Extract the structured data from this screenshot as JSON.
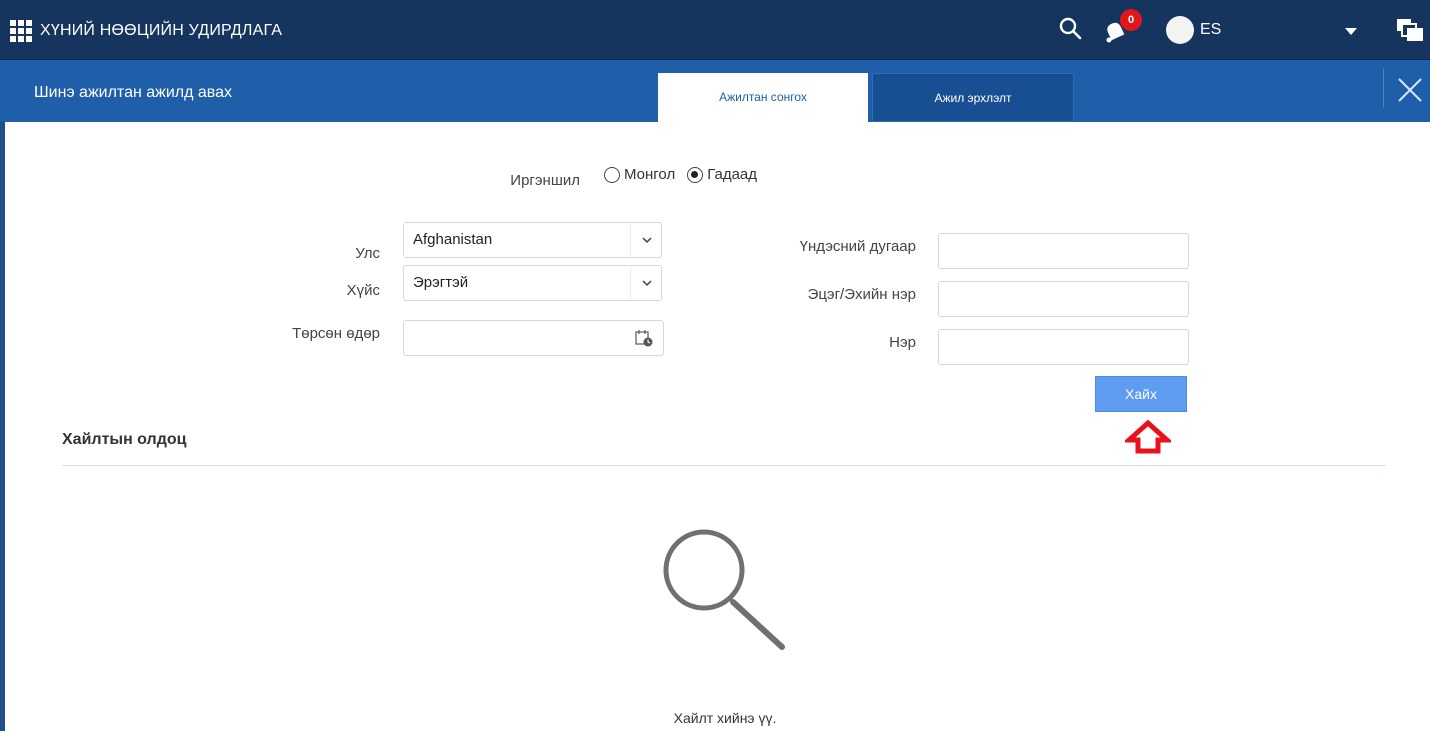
{
  "app": {
    "title": "ХҮНИЙ НӨӨЦИЙН УДИРДЛАГА",
    "notifications_count": "0",
    "user_initials": "ES"
  },
  "dialog": {
    "title": "Шинэ ажилтан ажилд авах",
    "tabs": [
      {
        "label": "Ажилтан сонгох",
        "active": true
      },
      {
        "label": "Ажил эрхлэлт",
        "active": false
      }
    ]
  },
  "form": {
    "citizenship": {
      "label": "Иргэншил",
      "options": [
        {
          "label": "Монгол",
          "selected": false
        },
        {
          "label": "Гадаад",
          "selected": true
        }
      ]
    },
    "country": {
      "label": "Улс",
      "value": "Afghanistan"
    },
    "gender": {
      "label": "Хүйс",
      "value": "Эрэгтэй"
    },
    "birth_date": {
      "label": "Төрсөн өдөр",
      "value": ""
    },
    "national_id": {
      "label": "Үндэсний дугаар",
      "value": ""
    },
    "parent_name": {
      "label": "Эцэг/Эхийн нэр",
      "value": ""
    },
    "first_name": {
      "label": "Нэр",
      "value": ""
    },
    "search_button": "Хайх"
  },
  "results": {
    "title": "Хайлтын олдоц",
    "empty_message": "Хайлт хийнэ үү."
  },
  "colors": {
    "topbar": "#15345e",
    "dialog_header": "#1f5ea8",
    "primary_button": "#5d9cf0",
    "badge": "#e0161b",
    "highlight_arrow": "#e8111c"
  }
}
